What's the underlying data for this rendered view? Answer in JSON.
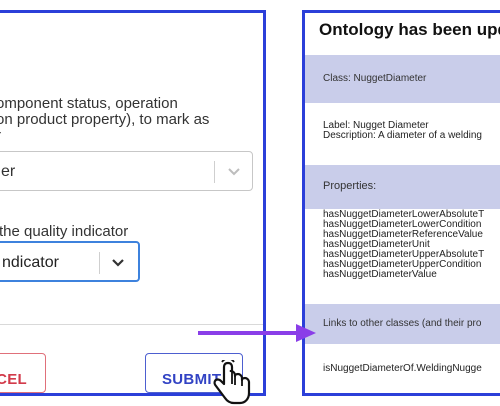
{
  "dialog": {
    "question_1": "…or component status, operation (…on product property), to mark as …r",
    "question_1_lines": [
      "omponent status, operation",
      "on product property), to mark as",
      "r"
    ],
    "select_1_value": "er",
    "question_2": "the quality indicator",
    "select_2_value": "ndicator",
    "cancel_label": "NCEL",
    "submit_label": "SUBMIT"
  },
  "panel": {
    "title": "Ontology has been upd",
    "class_band": "Class: NuggetDiameter",
    "label_line": "Label: Nugget Diameter",
    "description_line": "Description: A diameter of a welding",
    "properties_band": "Properties:",
    "properties": [
      "hasNuggetDiameterLowerAbsoluteT",
      "hasNuggetDiameterLowerCondition",
      "hasNuggetDiameterReferenceValue",
      "hasNuggetDiameterUnit",
      "hasNuggetDiameterUpperAbsoluteT",
      "hasNuggetDiameterUpperCondition",
      "hasNuggetDiameterValue"
    ],
    "links_band": "Links to other classes (and their pro",
    "link_item": "isNuggetDiameterOf.WeldingNugge"
  },
  "colors": {
    "frame": "#2b3fd9",
    "band": "#c9cdea",
    "arrow": "#8a3ee8",
    "cancel": "#d23a4a",
    "submit": "#3243c4",
    "focus": "#3d82dd"
  }
}
